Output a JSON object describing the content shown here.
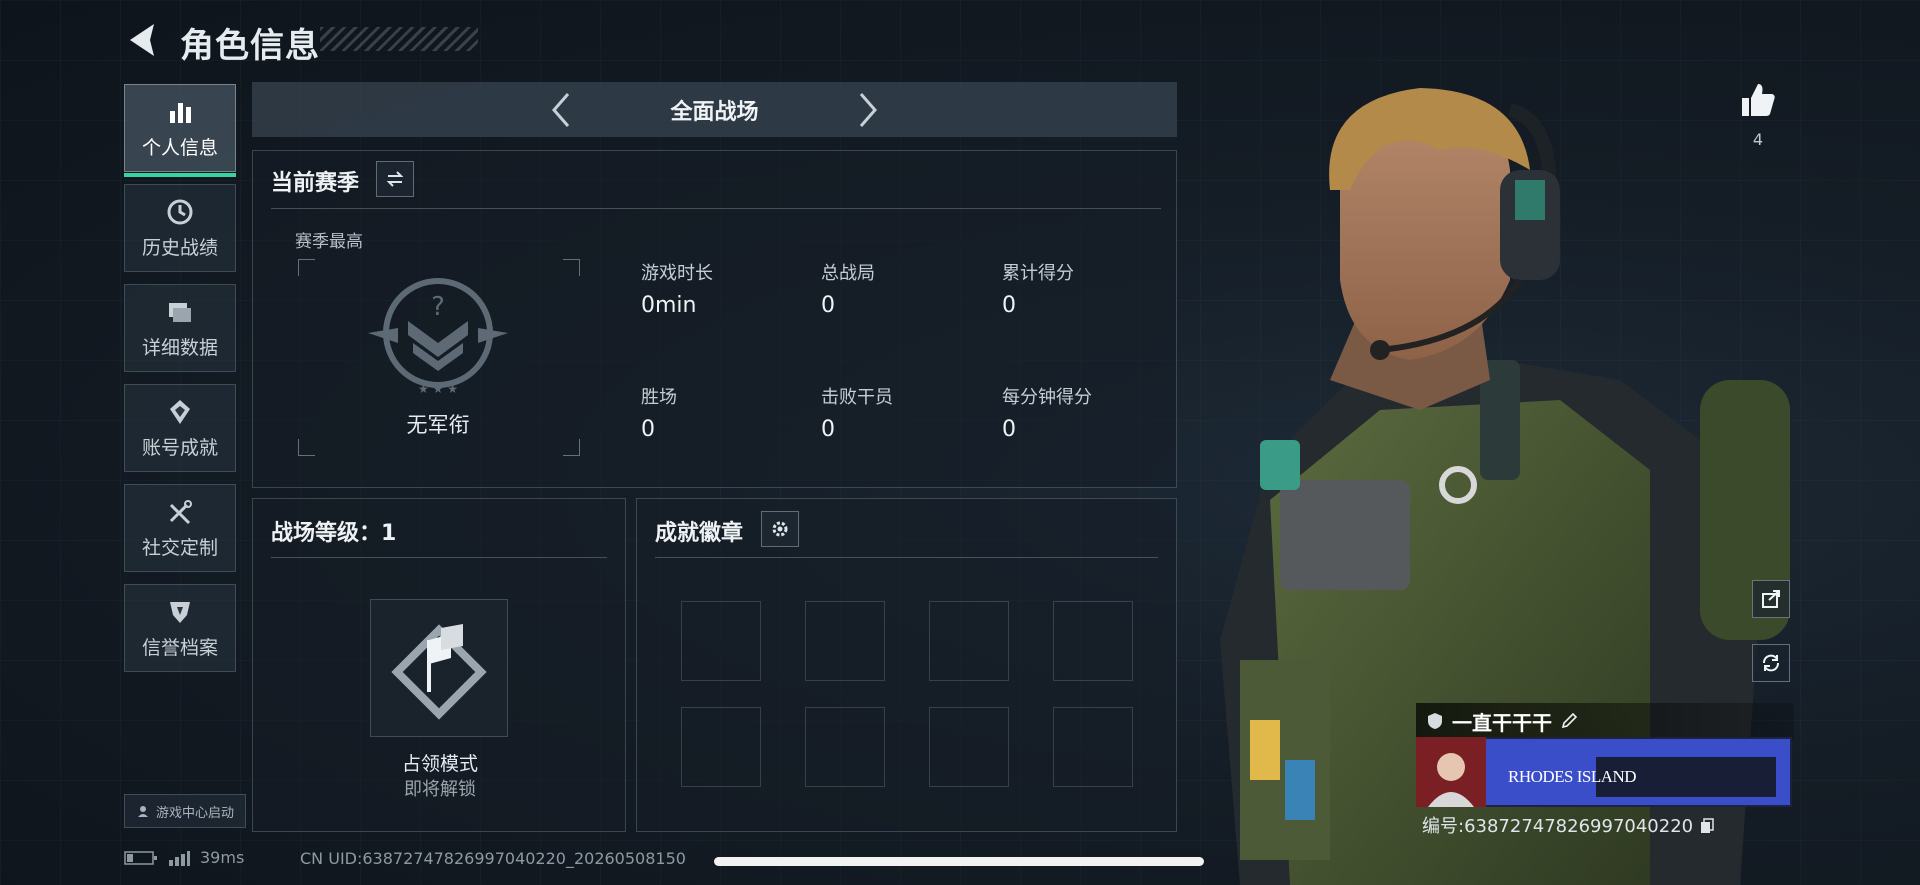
{
  "header": {
    "title": "角色信息"
  },
  "sidebar": {
    "items": [
      {
        "label": "个人信息",
        "icon": "bar-chart-icon",
        "active": true
      },
      {
        "label": "历史战绩",
        "icon": "clock-icon"
      },
      {
        "label": "详细数据",
        "icon": "folder-icon"
      },
      {
        "label": "账号成就",
        "icon": "medal-icon"
      },
      {
        "label": "社交定制",
        "icon": "tools-icon"
      },
      {
        "label": "信誉档案",
        "icon": "shield-icon"
      }
    ],
    "launch_label": "游戏中心启动"
  },
  "mode": {
    "title": "全面战场"
  },
  "season": {
    "title": "当前赛季",
    "best_label": "赛季最高",
    "rank_name": "无军衔",
    "stats": [
      {
        "label": "游戏时长",
        "value": "0min"
      },
      {
        "label": "总战局",
        "value": "0"
      },
      {
        "label": "累计得分",
        "value": "0"
      },
      {
        "label": "胜场",
        "value": "0"
      },
      {
        "label": "击败干员",
        "value": "0"
      },
      {
        "label": "每分钟得分",
        "value": "0"
      }
    ]
  },
  "level": {
    "title": "战场等级：1",
    "mode_name": "占领模式",
    "mode_status": "即将解锁"
  },
  "badges": {
    "title": "成就徽章",
    "slots": 8
  },
  "profile": {
    "likes": "4",
    "player_name": "一直干干干",
    "banner_text": "RHODES ISLAND",
    "id_text": "编号:638727478269970402​20"
  },
  "status": {
    "ping": "39ms",
    "cn_uid": "CN UID:638727478269970402​20_20260508150"
  },
  "colors": {
    "accent": "#39d3a0",
    "bg": "#141c25",
    "banner": "#3b4ec9"
  }
}
